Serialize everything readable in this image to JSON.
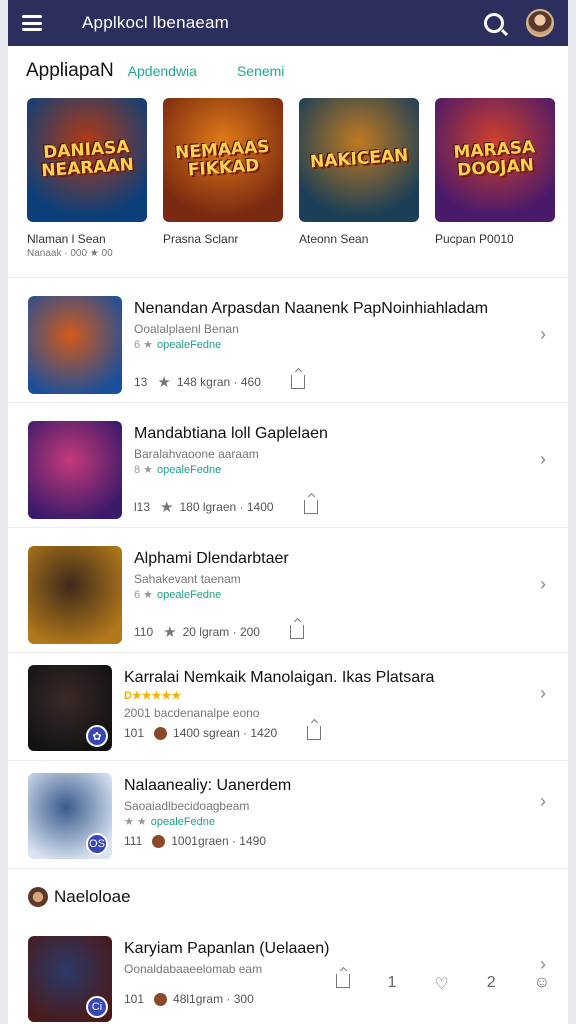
{
  "header": {
    "title": "Applkocl lbenaeam"
  },
  "tabs": {
    "main": "AppliapaN",
    "tab1": "Apdendwia",
    "tab2": "Senemi"
  },
  "featured": [
    {
      "art_text": "DANIASA NEARAAN",
      "caption": "Nlaman l Sean",
      "sub": "Nanaak · 000 ★ 00",
      "colors": [
        "#0c3f7a",
        "#b23a12"
      ]
    },
    {
      "art_text": "NEMAAAS FIKKAD",
      "caption": "Prasna Sclanr",
      "sub": "",
      "colors": [
        "#7a2a10",
        "#e07a18"
      ]
    },
    {
      "art_text": "NAKICEAN",
      "caption": "Ateonn Sean",
      "sub": "",
      "colors": [
        "#1a3f56",
        "#c07a20"
      ]
    },
    {
      "art_text": "MARASA DOOJAN",
      "caption": "Pucpan P0010",
      "sub": "",
      "colors": [
        "#4a1a6a",
        "#d0402a"
      ]
    }
  ],
  "list": [
    {
      "title": "Nenandan Arpasdan Naanenk PapNoinhiahladam",
      "sub": "Ooalalplaenl Benan",
      "tag": "opealeFedne",
      "meta_a": "13",
      "meta_b": "148 kgran · 460",
      "colors": [
        "#1c4f9a",
        "#d25a1a"
      ],
      "badge": ""
    },
    {
      "title": "Mandabtiana loll Gaplelaen",
      "sub": "Baralahvaoone aaraam",
      "tag": "opealeFedne",
      "meta_a": "l13",
      "meta_b": "180 lgraen · 1400",
      "colors": [
        "#3a1a6a",
        "#c43a7a"
      ],
      "badge": ""
    },
    {
      "title": "Alphami Dlendarbtaer",
      "sub": "Sahakevant taenam",
      "tag": "opealeFedne",
      "meta_a": "110",
      "meta_b": "20 lgram · 200",
      "colors": [
        "#b3781a",
        "#3d2a1a"
      ],
      "badge": ""
    },
    {
      "title": "Karralai Nemkaik Manolaigan. Ikas Platsara",
      "sub": "2001 bacdenanalpe eono",
      "stars": "D★★★★★",
      "meta_a": "101",
      "meta_b": "1400 sgrean · 1420",
      "colors": [
        "#121212",
        "#3a2a28"
      ],
      "badge": "✿"
    },
    {
      "title": "Nalaanealiy: Uanerdem",
      "sub": "Saoaiadlbecidoagbeam",
      "tag": "opealeFedne",
      "meta_a": "111",
      "meta_b": "1001graen · 1490",
      "colors": [
        "#d9e4f2",
        "#3a5a8c"
      ],
      "badge": "OS"
    }
  ],
  "section": {
    "title": "Naeloloae"
  },
  "last": {
    "title": "Karyiam Papanlan (Uelaaen)",
    "sub": "Oonaldabaaeelomab eam",
    "meta_a": "101",
    "meta_b": "48l1gram · 300",
    "colors": [
      "#4a1a1a",
      "#2a3a6a"
    ],
    "badge": "Ci"
  },
  "bottom_bar": {
    "icons": [
      "share-icon",
      "1",
      "heart-icon",
      "2",
      "emoji-icon"
    ]
  }
}
